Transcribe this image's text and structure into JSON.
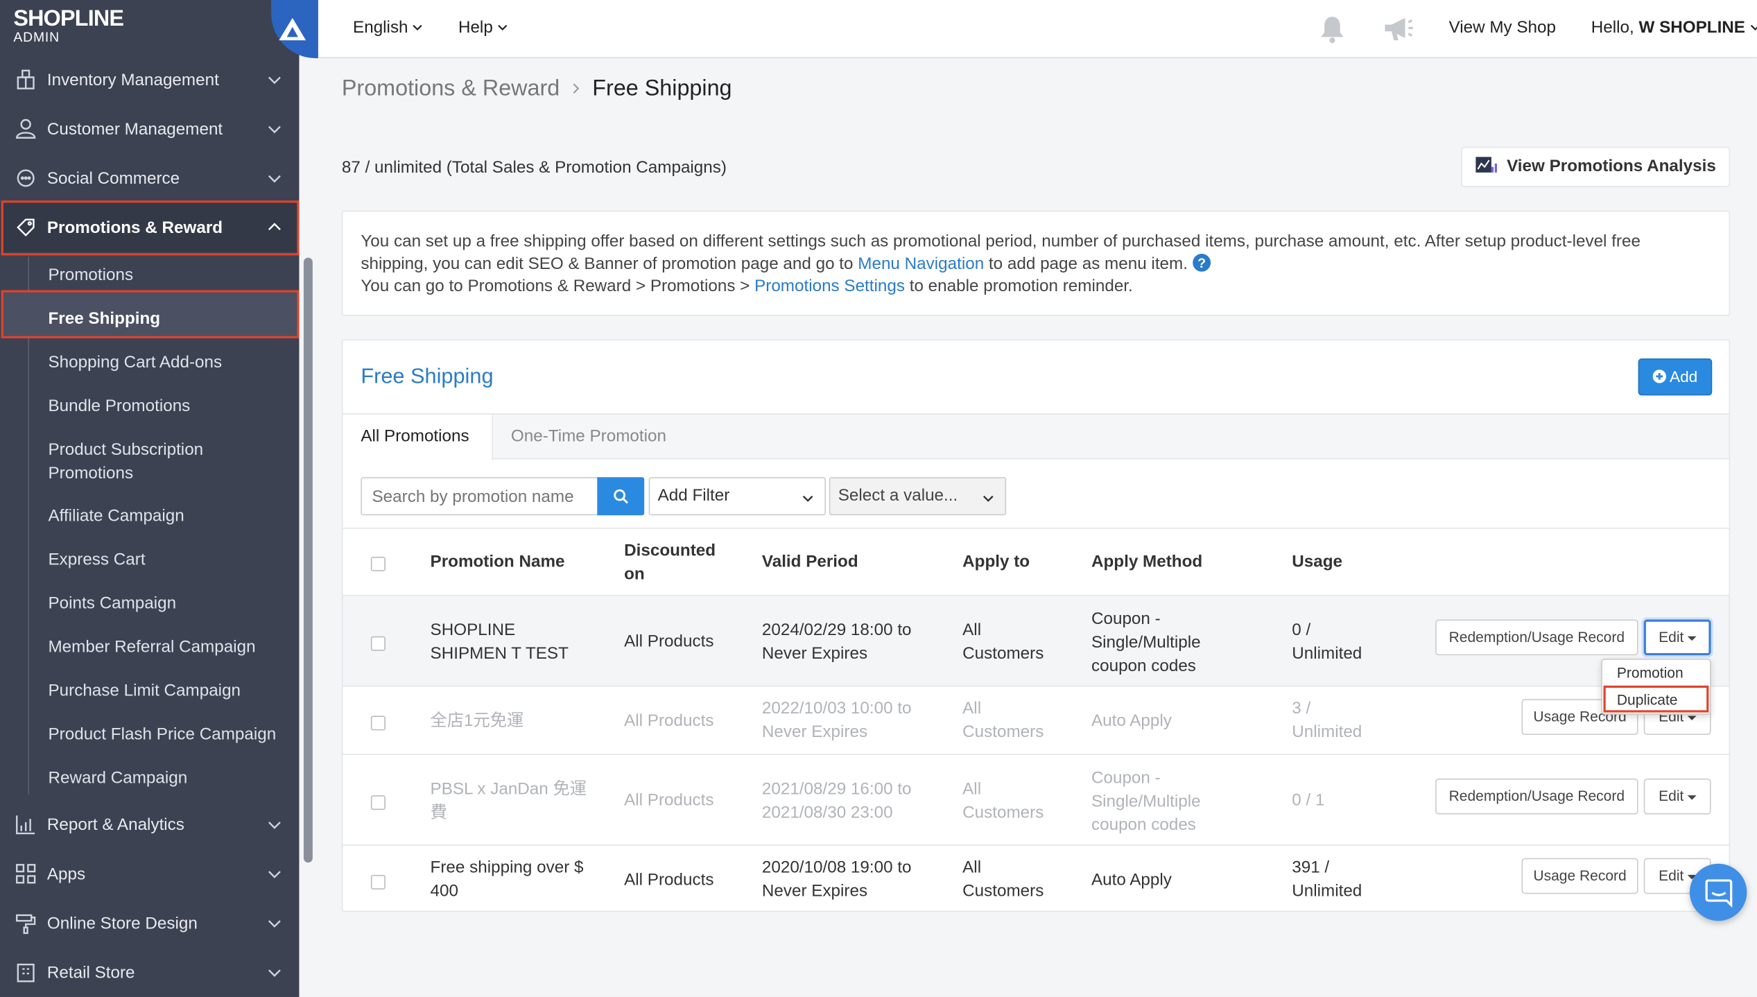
{
  "brand": {
    "name": "SHOPLINE",
    "sub": "ADMIN"
  },
  "sidebar": {
    "items": [
      {
        "label": "Inventory Management",
        "icon": "inventory-icon"
      },
      {
        "label": "Customer Management",
        "icon": "customer-icon"
      },
      {
        "label": "Social Commerce",
        "icon": "chat-icon"
      },
      {
        "label": "Promotions & Reward",
        "icon": "tag-icon"
      },
      {
        "label": "Report & Analytics",
        "icon": "chart-icon"
      },
      {
        "label": "Apps",
        "icon": "apps-icon"
      },
      {
        "label": "Online Store Design",
        "icon": "paint-roller-icon"
      },
      {
        "label": "Retail Store",
        "icon": "store-icon"
      }
    ],
    "sub_items": [
      "Promotions",
      "Free Shipping",
      "Shopping Cart Add-ons",
      "Bundle Promotions",
      "Product Subscription Promotions",
      "Affiliate Campaign",
      "Express Cart",
      "Points Campaign",
      "Member Referral Campaign",
      "Purchase Limit Campaign",
      "Product Flash Price Campaign",
      "Reward Campaign"
    ]
  },
  "topbar": {
    "language": "English",
    "help": "Help",
    "view_shop": "View My Shop",
    "hello": "Hello, ",
    "user": "W SHOPLINE"
  },
  "breadcrumb": {
    "parent": "Promotions & Reward",
    "current": "Free Shipping"
  },
  "summary": {
    "count_text": "87 / unlimited (Total Sales & Promotion Campaigns)",
    "analysis_button": "View Promotions Analysis"
  },
  "info": {
    "line1": "You can set up a free shipping offer based on different settings such as promotional period, number of purchased items, purchase amount, etc. After setup product-level free",
    "line2_pre": "shipping, you can edit SEO & Banner of promotion page and go to ",
    "line2_link": "Menu Navigation",
    "line2_post": " to add page as menu item.",
    "line3_pre": "You can go to Promotions & Reward > Promotions > ",
    "line3_link": "Promotions Settings",
    "line3_post": " to enable promotion reminder."
  },
  "section": {
    "title": "Free Shipping",
    "add_button": "Add"
  },
  "tabs": [
    "All Promotions",
    "One-Time Promotion"
  ],
  "filters": {
    "search_placeholder": "Search by promotion name",
    "add_filter": "Add Filter",
    "select_value": "Select a value..."
  },
  "table": {
    "headers": [
      "Promotion Name",
      "Discounted on",
      "Valid Period",
      "Apply to",
      "Apply Method",
      "Usage"
    ],
    "rows": [
      {
        "name": "SHOPLINE SHIPMEN T TEST",
        "discount": "All Products",
        "period": "2024/02/29 18:00 to Never Expires",
        "apply_to": "All Customers",
        "method": "Coupon - Single/Multiple coupon codes",
        "usage": "0 / Unlimited",
        "record_button": "Redemption/Usage Record",
        "edit": "Edit"
      },
      {
        "name": "全店1元免運",
        "discount": "All Products",
        "period": "2022/10/03 10:00 to Never Expires",
        "apply_to": "All Customers",
        "method": "Auto Apply",
        "usage": "3 / Unlimited",
        "record_button": "Usage Record",
        "edit": "Edit"
      },
      {
        "name": "PBSL x JanDan 免運費",
        "discount": "All Products",
        "period": "2021/08/29 16:00 to 2021/08/30 23:00",
        "apply_to": "All Customers",
        "method": "Coupon - Single/Multiple coupon codes",
        "usage": "0 / 1",
        "record_button": "Redemption/Usage Record",
        "edit": "Edit"
      },
      {
        "name": "Free shipping over $ 400",
        "discount": "All Products",
        "period": "2020/10/08 19:00 to Never Expires",
        "apply_to": "All Customers",
        "method": "Auto Apply",
        "usage": "391 / Unlimited",
        "record_button": "Usage Record",
        "edit": "Edit"
      }
    ]
  },
  "edit_menu": {
    "items": [
      "Promotion",
      "Duplicate"
    ]
  },
  "colors": {
    "sidebar": "#3c4252",
    "accent": "#2a7bc9",
    "highlight": "#e0432b"
  }
}
